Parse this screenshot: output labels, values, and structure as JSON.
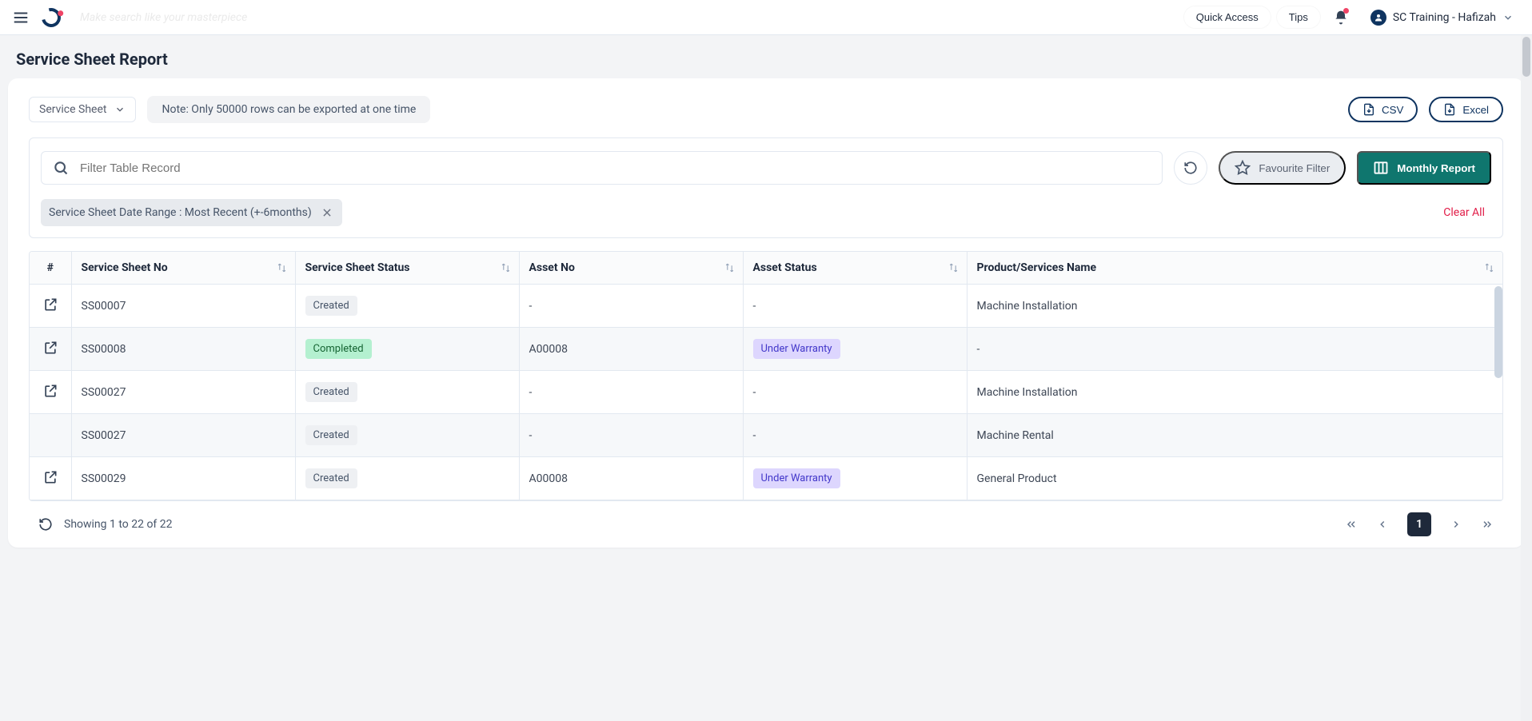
{
  "appbar": {
    "search_placeholder": "Make search like your masterpiece",
    "quick_access": "Quick Access",
    "tips": "Tips",
    "user_label": "SC Training - Hafizah"
  },
  "page": {
    "title": "Service Sheet Report"
  },
  "controls": {
    "dropdown_label": "Service Sheet",
    "note": "Note: Only 50000 rows can be exported at one time",
    "csv_label": "CSV",
    "excel_label": "Excel"
  },
  "filter": {
    "search_placeholder": "Filter Table Record",
    "favourite_label": "Favourite Filter",
    "monthly_label": "Monthly Report",
    "chip_text": "Service Sheet Date Range :  Most Recent (+-6months)",
    "clear_all": "Clear All"
  },
  "table": {
    "headers": {
      "idx": "#",
      "ssno": "Service Sheet No",
      "status": "Service Sheet Status",
      "asset": "Asset No",
      "astat": "Asset Status",
      "prod": "Product/Services Name"
    },
    "rows": [
      {
        "open": true,
        "ssno": "SS00007",
        "status": "Created",
        "asset": "-",
        "astat": "-",
        "prod": "Machine Installation"
      },
      {
        "open": true,
        "ssno": "SS00008",
        "status": "Completed",
        "asset": "A00008",
        "astat": "Under Warranty",
        "prod": "-"
      },
      {
        "open": true,
        "ssno": "SS00027",
        "status": "Created",
        "asset": "-",
        "astat": "-",
        "prod": "Machine Installation"
      },
      {
        "open": false,
        "ssno": "SS00027",
        "status": "Created",
        "asset": "-",
        "astat": "-",
        "prod": "Machine Rental"
      },
      {
        "open": true,
        "ssno": "SS00029",
        "status": "Created",
        "asset": "A00008",
        "astat": "Under Warranty",
        "prod": "General Product"
      }
    ]
  },
  "status_styles": {
    "Created": "b-created",
    "Completed": "b-completed",
    "Under Warranty": "b-warranty"
  },
  "pager": {
    "info": "Showing 1 to 22 of 22",
    "current": "1"
  }
}
